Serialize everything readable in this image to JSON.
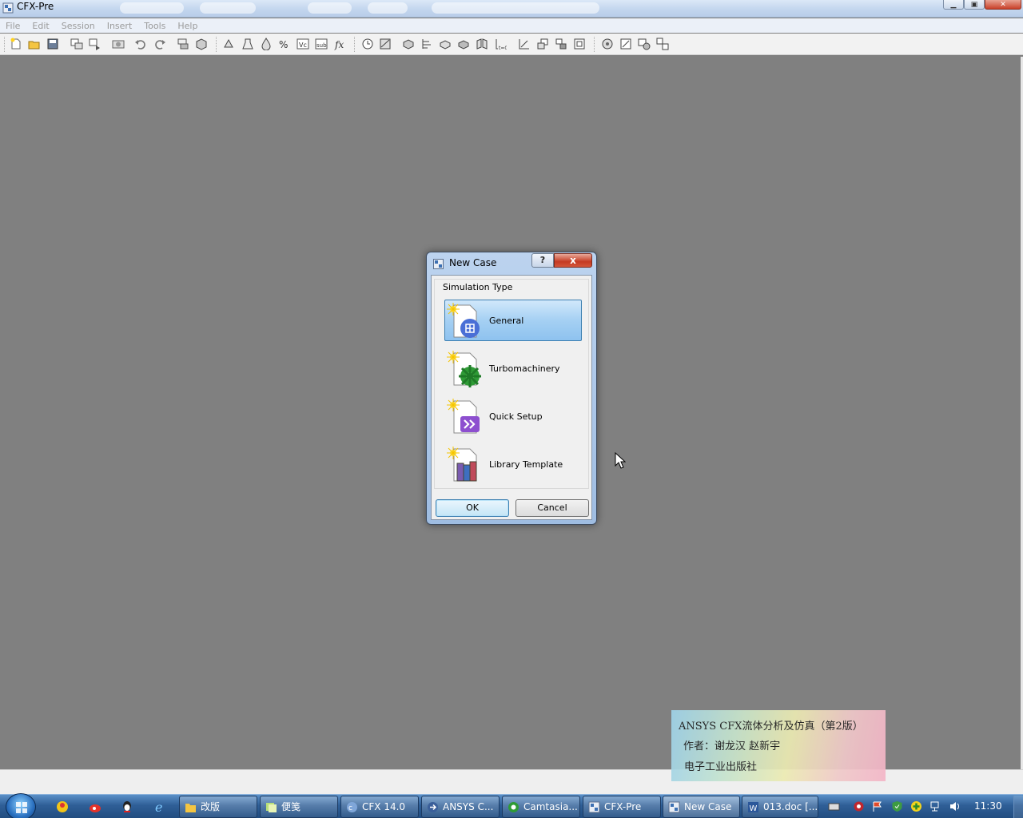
{
  "window": {
    "title": "CFX-Pre",
    "controls": [
      "minimize",
      "maximize",
      "close"
    ]
  },
  "menubar": {
    "items": [
      "File",
      "Edit",
      "Session",
      "Insert",
      "Tools",
      "Help"
    ]
  },
  "toolbar": {
    "icons": [
      "new-case-icon",
      "open-icon",
      "save-icon",
      "import-mesh-icon",
      "export-icon",
      "screenshot-icon",
      "undo-icon",
      "redo-icon",
      "insert-domain-icon",
      "insert-boundary-icon",
      "subdomain-icon",
      "source-icon",
      "interface-icon",
      "expression-icon",
      "additional-variable-icon",
      "user-function-icon",
      "function-icon",
      "timestep-icon",
      "solver-control-icon",
      "output-control-icon",
      "monitor-icon",
      "mesh-adaptation-icon",
      "material-icon",
      "reaction-icon",
      "coord-frame-icon",
      "transform-icon",
      "composite-icon",
      "copy-icon",
      "validate-icon",
      "write-solver-icon",
      "solver-input-icon",
      "define-run-icon"
    ]
  },
  "dialog": {
    "title": "New Case",
    "help_label": "?",
    "close_label": "x",
    "group_label": "Simulation Type",
    "items": [
      {
        "label": "General",
        "icon": "general-case-icon",
        "selected": true
      },
      {
        "label": "Turbomachinery",
        "icon": "turbomachinery-icon",
        "selected": false
      },
      {
        "label": "Quick Setup",
        "icon": "quick-setup-icon",
        "selected": false
      },
      {
        "label": "Library Template",
        "icon": "library-template-icon",
        "selected": false
      }
    ],
    "ok_label": "OK",
    "cancel_label": "Cancel"
  },
  "watermark": {
    "line1": "ANSYS CFX流体分析及仿真（第2版）",
    "line2": "作者：谢龙汉  赵新宇",
    "line3": "电子工业出版社"
  },
  "taskbar": {
    "quick_launch": [
      "fetion-icon",
      "weibo-icon",
      "qq-icon",
      "ie-icon"
    ],
    "tasks": [
      {
        "label": "改版",
        "icon": "folder-icon"
      },
      {
        "label": "便笺",
        "icon": "notes-icon"
      },
      {
        "label": "CFX 14.0",
        "icon": "cfx-icon"
      },
      {
        "label": "ANSYS C...",
        "icon": "ansys-icon"
      },
      {
        "label": "Camtasia...",
        "icon": "camtasia-icon"
      },
      {
        "label": "CFX-Pre",
        "icon": "cfxpre-icon"
      },
      {
        "label": "New Case",
        "icon": "cfxpre-icon"
      },
      {
        "label": "013.doc [...",
        "icon": "word-icon"
      }
    ],
    "tray": [
      "keyboard-icon",
      "record-icon",
      "flag-icon",
      "shield-icon",
      "plus-icon",
      "network-icon",
      "volume-icon"
    ],
    "clock": "11:30"
  },
  "colors": {
    "workspace": "#808080",
    "selection": "#9fcdf1",
    "taskbar": "#2f5f97"
  }
}
